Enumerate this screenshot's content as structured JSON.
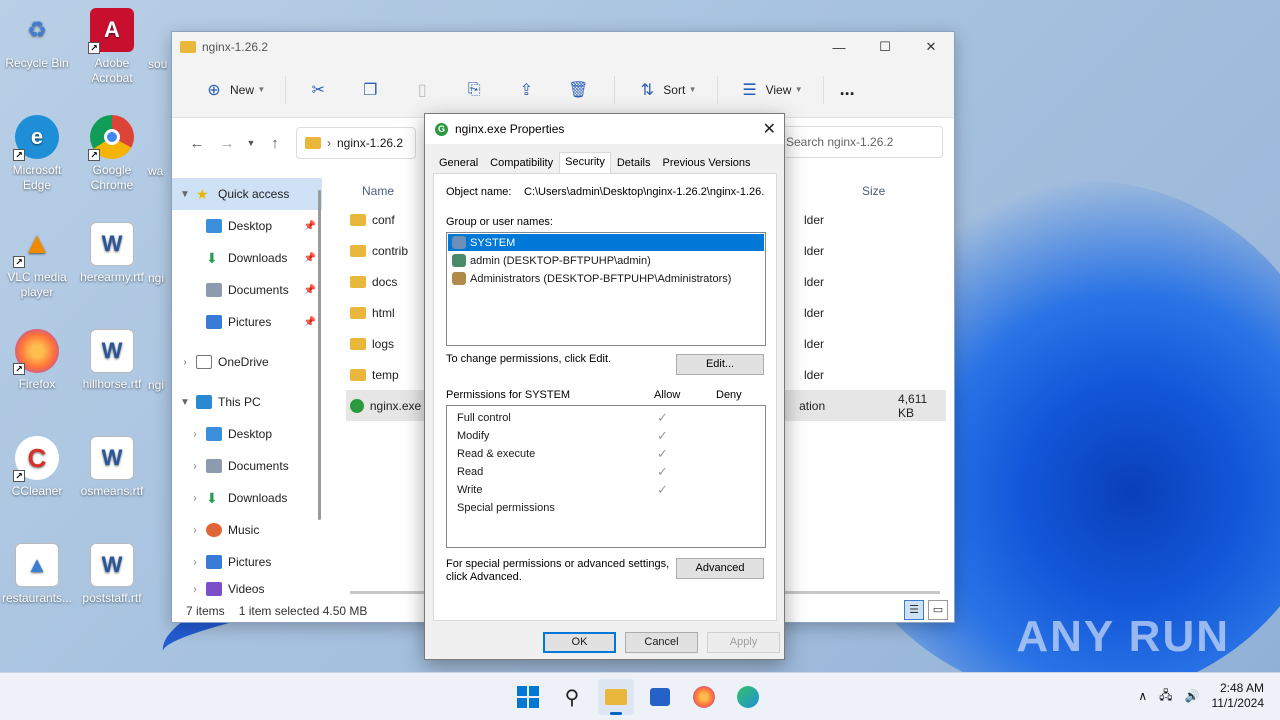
{
  "desktop": {
    "icons": [
      {
        "label": "Recycle Bin",
        "icon": "recycle-bin-icon"
      },
      {
        "label": "Adobe Acrobat",
        "icon": "acrobat-icon"
      },
      {
        "label": "Microsoft Edge",
        "icon": "edge-icon"
      },
      {
        "label": "Google Chrome",
        "icon": "chrome-icon"
      },
      {
        "label": "VLC media player",
        "icon": "vlc-icon"
      },
      {
        "label": "herearmy.rtf",
        "icon": "word-doc-icon"
      },
      {
        "label": "Firefox",
        "icon": "firefox-icon"
      },
      {
        "label": "hillhorse.rtf",
        "icon": "word-doc-icon"
      },
      {
        "label": "CCleaner",
        "icon": "ccleaner-icon"
      },
      {
        "label": "osmeans.rtf",
        "icon": "word-doc-icon"
      },
      {
        "label": "restaurants...",
        "icon": "image-file-icon"
      },
      {
        "label": "poststaff.rtf",
        "icon": "word-doc-icon"
      }
    ],
    "partial_labels": [
      "sou",
      "wa",
      "ngi",
      "ngi"
    ]
  },
  "explorer": {
    "title": "nginx-1.26.2",
    "toolbar": {
      "new_label": "New",
      "sort_label": "Sort",
      "view_label": "View",
      "more_label": "..."
    },
    "address": "nginx-1.26.2",
    "search_placeholder": "Search nginx-1.26.2",
    "nav": {
      "quick_access": "Quick access",
      "desktop": "Desktop",
      "downloads": "Downloads",
      "documents": "Documents",
      "pictures": "Pictures",
      "onedrive": "OneDrive",
      "this_pc": "This PC",
      "pc_desktop": "Desktop",
      "pc_documents": "Documents",
      "pc_downloads": "Downloads",
      "pc_music": "Music",
      "pc_pictures": "Pictures",
      "pc_videos": "Videos"
    },
    "columns": {
      "name": "Name",
      "size": "Size"
    },
    "files": [
      {
        "name": "conf",
        "type_partial": "lder",
        "size": ""
      },
      {
        "name": "contrib",
        "type_partial": "lder",
        "size": ""
      },
      {
        "name": "docs",
        "type_partial": "lder",
        "size": ""
      },
      {
        "name": "html",
        "type_partial": "lder",
        "size": ""
      },
      {
        "name": "logs",
        "type_partial": "lder",
        "size": ""
      },
      {
        "name": "temp",
        "type_partial": "lder",
        "size": ""
      },
      {
        "name": "nginx.exe",
        "type_partial": "ation",
        "size": "4,611 KB"
      }
    ],
    "status": {
      "items": "7 items",
      "selected": "1 item selected  4.50 MB"
    }
  },
  "dialog": {
    "title": "nginx.exe Properties",
    "tabs": [
      "General",
      "Compatibility",
      "Security",
      "Details",
      "Previous Versions"
    ],
    "active_tab": "Security",
    "object_name_label": "Object name:",
    "object_name_value": "C:\\Users\\admin\\Desktop\\nginx-1.26.2\\nginx-1.26.",
    "group_label": "Group or user names:",
    "users": [
      "SYSTEM",
      "admin (DESKTOP-BFTPUHP\\admin)",
      "Administrators (DESKTOP-BFTPUHP\\Administrators)"
    ],
    "change_text": "To change permissions, click Edit.",
    "edit_button": "Edit...",
    "permissions_for": "Permissions for SYSTEM",
    "allow_label": "Allow",
    "deny_label": "Deny",
    "permissions": [
      {
        "name": "Full control",
        "allow": true
      },
      {
        "name": "Modify",
        "allow": true
      },
      {
        "name": "Read & execute",
        "allow": true
      },
      {
        "name": "Read",
        "allow": true
      },
      {
        "name": "Write",
        "allow": true
      },
      {
        "name": "Special permissions",
        "allow": false
      }
    ],
    "advanced_text_1": "For special permissions or advanced settings,",
    "advanced_text_2": "click Advanced.",
    "advanced_button": "Advanced",
    "ok_button": "OK",
    "cancel_button": "Cancel",
    "apply_button": "Apply"
  },
  "taskbar": {
    "time": "2:48 AM",
    "date": "11/1/2024"
  },
  "watermark": "ANY RUN"
}
